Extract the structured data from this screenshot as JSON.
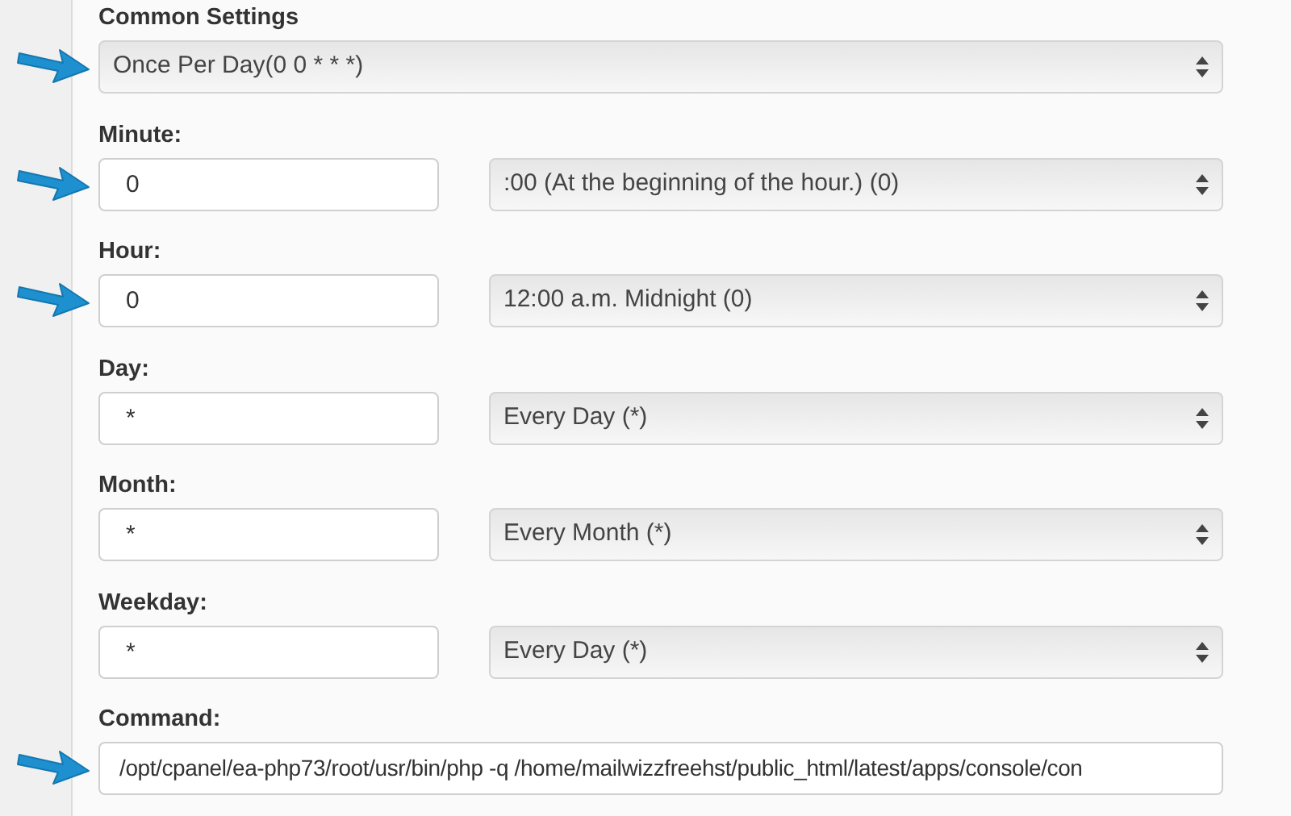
{
  "common_settings": {
    "label": "Common Settings",
    "value": "Once Per Day(0 0 * * *)",
    "arrow": true
  },
  "fields": [
    {
      "label": "Minute:",
      "value": "0",
      "option": ":00 (At the beginning of the hour.) (0)",
      "arrow": true
    },
    {
      "label": "Hour:",
      "value": "0",
      "option": "12:00 a.m. Midnight (0)",
      "arrow": true
    },
    {
      "label": "Day:",
      "value": "*",
      "option": "Every Day (*)",
      "arrow": false
    },
    {
      "label": "Month:",
      "value": "*",
      "option": "Every Month (*)",
      "arrow": false
    },
    {
      "label": "Weekday:",
      "value": "*",
      "option": "Every Day (*)",
      "arrow": false
    }
  ],
  "command": {
    "label": "Command:",
    "value": "/opt/cpanel/ea-php73/root/usr/bin/php -q /home/mailwizzfreehst/public_html/latest/apps/console/con",
    "arrow": true
  }
}
